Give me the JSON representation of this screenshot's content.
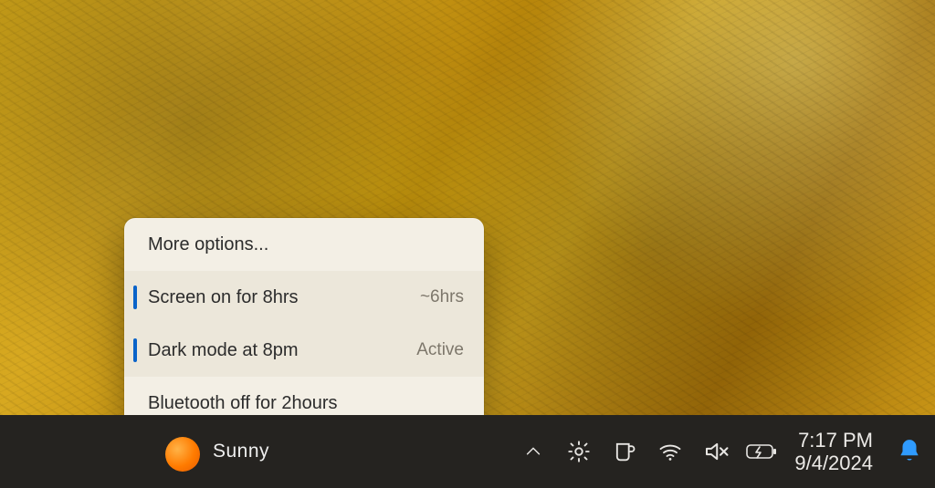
{
  "flyout": {
    "more_options": "More options...",
    "items": [
      {
        "label": "Screen on for 8hrs",
        "secondary": "~6hrs",
        "accent": true,
        "highlight": true
      },
      {
        "label": "Dark mode at 8pm",
        "secondary": "Active",
        "accent": true,
        "highlight": true
      },
      {
        "label": "Bluetooth off for 2hours",
        "secondary": "",
        "accent": false,
        "highlight": false
      }
    ]
  },
  "weather": {
    "label": "Sunny"
  },
  "clock": {
    "time": "7:17 PM",
    "date": "9/4/2024"
  },
  "colors": {
    "taskbar_bg": "#252320",
    "flyout_bg": "#f3efe5",
    "accent_blue": "#0a63c9",
    "bell_blue": "#2f9bff"
  }
}
